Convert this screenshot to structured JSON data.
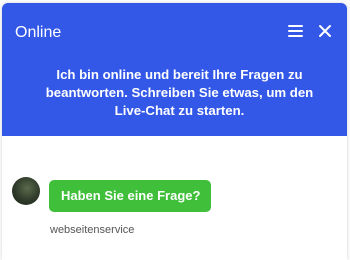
{
  "header": {
    "status": "Online",
    "message": "Ich bin online und bereit Ihre Fragen zu beantworten. Schreiben Sie etwas, um den Live-Chat zu starten.",
    "menu_icon": "hamburger-menu-icon",
    "close_icon": "close-icon"
  },
  "chat": {
    "messages": [
      {
        "text": "Haben Sie eine Frage?",
        "sender": "webseitenservice"
      }
    ]
  },
  "colors": {
    "header_bg": "#3358e8",
    "bubble_bg": "#3fbf3a"
  }
}
